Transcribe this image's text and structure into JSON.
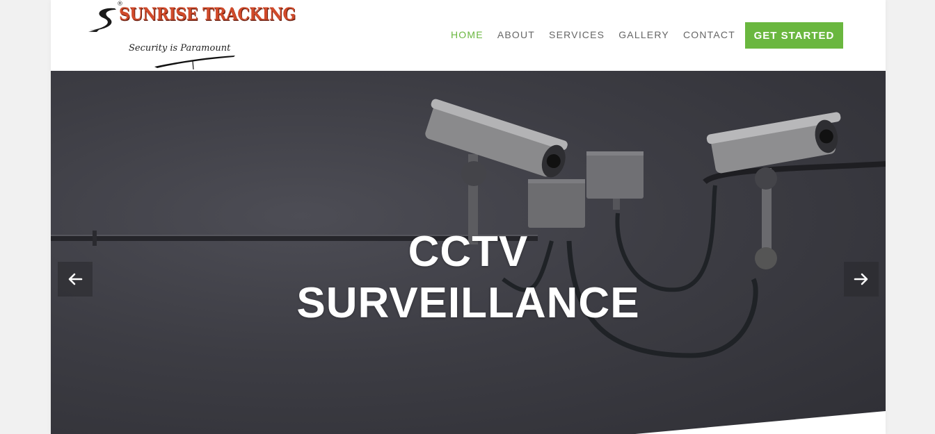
{
  "brand": {
    "name": "SUNRISE TRACKING",
    "registered_mark": "®",
    "tagline": "Security is Paramount",
    "name_color": "#d14a2a"
  },
  "nav": {
    "items": [
      {
        "label": "HOME",
        "active": true
      },
      {
        "label": "ABOUT",
        "active": false
      },
      {
        "label": "SERVICES",
        "active": false
      },
      {
        "label": "GALLERY",
        "active": false
      },
      {
        "label": "CONTACT",
        "active": false
      }
    ],
    "cta_label": "GET STARTED",
    "accent_color": "#6ab73f"
  },
  "hero": {
    "title_line1": "CCTV",
    "title_line2": "SURVEILLANCE",
    "prev_icon": "arrow-left-icon",
    "next_icon": "arrow-right-icon"
  }
}
